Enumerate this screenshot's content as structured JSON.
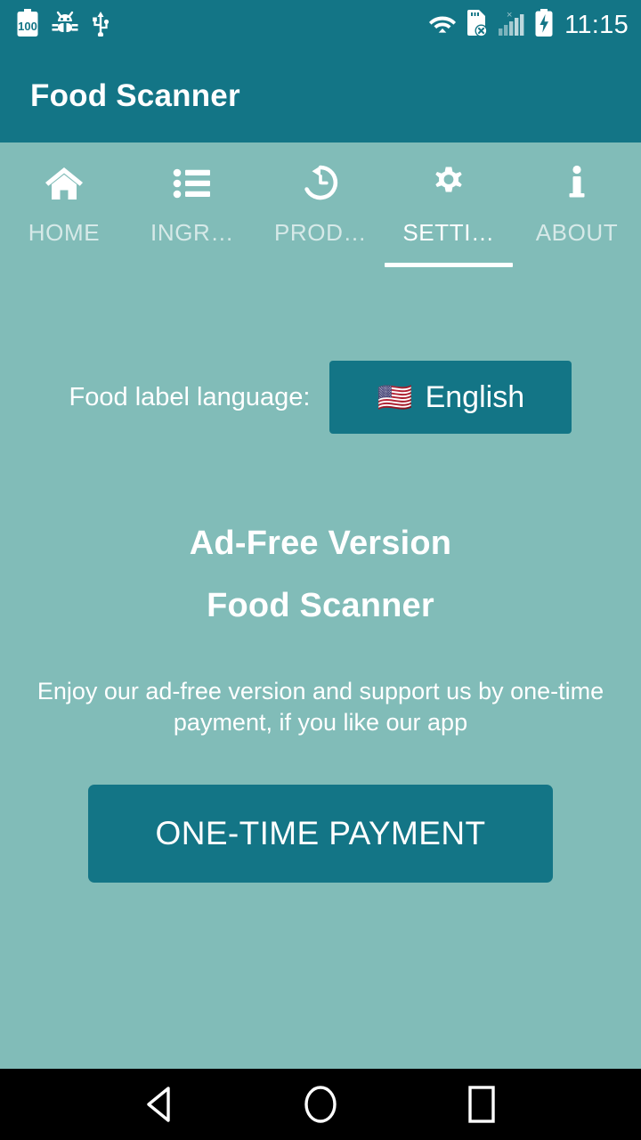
{
  "status_bar": {
    "time": "11:15",
    "left_icons": [
      {
        "name": "battery-100-icon",
        "label": "100"
      },
      {
        "name": "android-debug-bug-icon",
        "label": "adb"
      },
      {
        "name": "usb-icon",
        "label": "usb"
      }
    ],
    "right_icons": [
      {
        "name": "wifi-icon",
        "label": "wifi"
      },
      {
        "name": "sim-card-missing-icon",
        "label": "no-sim"
      },
      {
        "name": "cellular-signal-icon",
        "label": "signal"
      },
      {
        "name": "battery-charging-icon",
        "label": "charging"
      }
    ]
  },
  "app_bar": {
    "title": "Food Scanner"
  },
  "tabs": [
    {
      "label": "HOME",
      "icon": "home-icon",
      "selected": false
    },
    {
      "label": "INGR…",
      "icon": "list-icon",
      "selected": false
    },
    {
      "label": "PROD…",
      "icon": "history-icon",
      "selected": false
    },
    {
      "label": "SETTI…",
      "icon": "gear-icon",
      "selected": true
    },
    {
      "label": "ABOUT",
      "icon": "info-icon",
      "selected": false
    }
  ],
  "settings": {
    "language_label": "Food label language:",
    "language_flag": "🇺🇸",
    "language_value": "English"
  },
  "ad_free": {
    "title_line1": "Ad-Free Version",
    "title_line2": "Food Scanner",
    "description": "Enjoy our ad-free version and support us by one-time payment, if you like our app",
    "pay_button_label": "ONE-TIME PAYMENT"
  },
  "nav_bar": {
    "back": "back-button",
    "home": "home-button",
    "recents": "recents-button"
  },
  "colors": {
    "primary": "#137586",
    "background": "#81bcb8",
    "on_primary": "#ffffff",
    "nav_bar": "#000000"
  }
}
